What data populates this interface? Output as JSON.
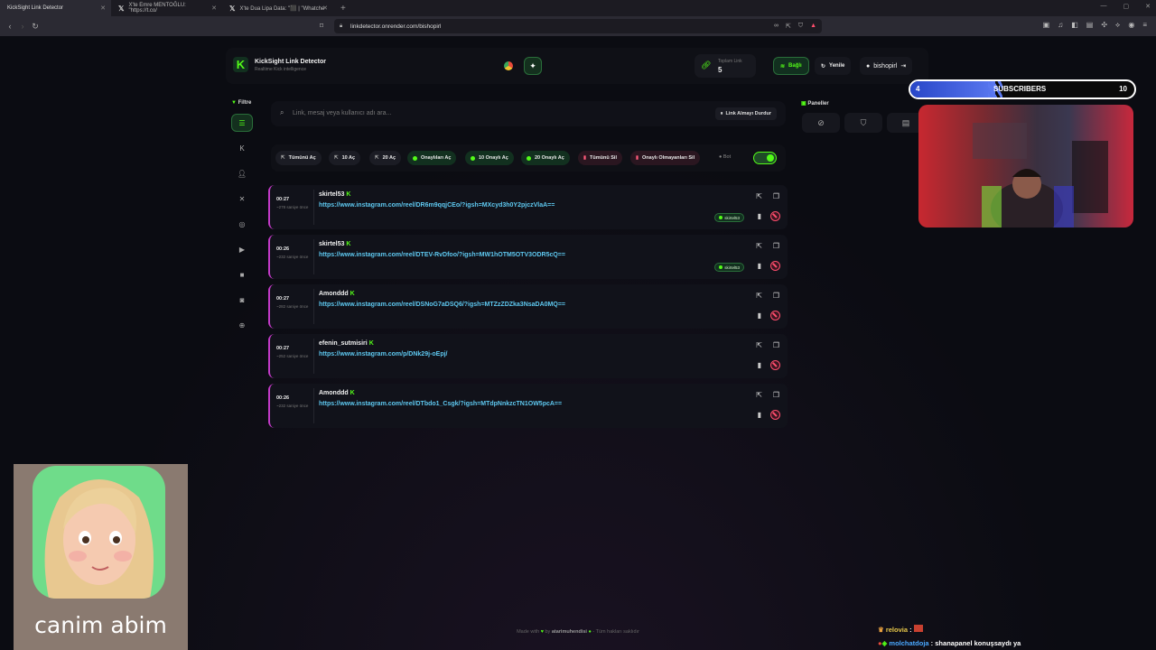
{
  "browser": {
    "tabs": [
      {
        "title": "KickSight Link Detector"
      },
      {
        "title": "X'te Emre MENTOĞLU: \"https://t.co/"
      },
      {
        "title": "X'te Dua Lipa Data: \"⬛ | \"Whatche"
      }
    ],
    "address": "linkdetector.onrender.com/bishopirl"
  },
  "app": {
    "brand": {
      "title": "KickSight Link Detector",
      "subtitle": "Realtime Kick intelligence",
      "logo_letter": "K",
      "accent": "#53fc18"
    },
    "stats": {
      "label": "Toplam Link",
      "value": "5"
    },
    "header_buttons": {
      "connected": "Bağlı",
      "refresh": "Yenile",
      "user": "bishopirl"
    },
    "sidebar": {
      "title": "Filtre"
    },
    "search": {
      "placeholder": "Link, mesaj veya kullanıcı adı ara...",
      "stop_label": "Link Almayı Durdur"
    },
    "actions": {
      "open_all": "Tümünü Aç",
      "open_10": "10 Aç",
      "open_20": "20 Aç",
      "open_approved": "Onaylıları Aç",
      "open_10_approved": "10 Onaylı Aç",
      "open_20_approved": "20 Onaylı Aç",
      "delete_all": "Tümünü Sil",
      "delete_unapproved": "Onaylı Olmayanları Sil",
      "bot_label": "Bot"
    },
    "links": [
      {
        "time": "00:27",
        "ago": "~278 saniye önce",
        "user": "skirtel53",
        "url": "https://www.instagram.com/reel/DR6m9qqjCEo/?igsh=MXcyd3h0Y2pjczVlaA==",
        "badge": "skirtel53"
      },
      {
        "time": "00:26",
        "ago": "~232 saniye önce",
        "user": "skirtel53",
        "url": "https://www.instagram.com/reel/DTEV-RvDfoo/?igsh=MW1hOTM5OTV3ODR5cQ==",
        "badge": "skirtel53"
      },
      {
        "time": "00:27",
        "ago": "~282 saniye önce",
        "user": "Amonddd",
        "url": "https://www.instagram.com/reel/DSNoG7aDSQ6/?igsh=MTZzZDZka3NsaDA0MQ==",
        "badge": ""
      },
      {
        "time": "00:27",
        "ago": "~252 saniye önce",
        "user": "efenin_sutmisiri",
        "url": "https://www.instagram.com/p/DNk29j-oEpj/",
        "badge": ""
      },
      {
        "time": "00:26",
        "ago": "~232 saniye önce",
        "user": "Amonddd",
        "url": "https://www.instagram.com/reel/DTbdo1_Csgk/?igsh=MTdpNnkzcTN1OW5pcA==",
        "badge": ""
      }
    ],
    "panels": {
      "title": "Paneller"
    },
    "footer": {
      "made_with": "Made with",
      "by": "by",
      "author": "atarimuhendisi",
      "rights": "- Tüm hakları saklıdır"
    }
  },
  "overlay": {
    "subs": {
      "current": "4",
      "label": "SUBSCRIBERS",
      "goal": "10",
      "progress": 0.38
    },
    "avatar_name": "canim abim",
    "chat": [
      {
        "user": "relovia",
        "message": ""
      },
      {
        "user": "molchatdoja",
        "message": "shanapanel konuşsaydı ya"
      }
    ]
  }
}
